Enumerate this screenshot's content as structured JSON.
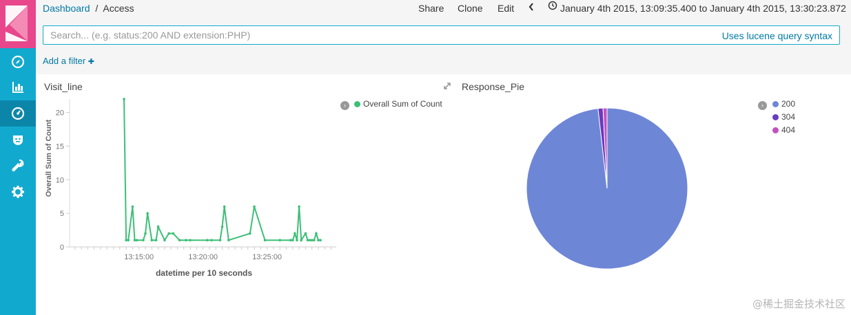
{
  "breadcrumb": {
    "parent": "Dashboard",
    "separator": "/",
    "current": "Access"
  },
  "top_menu": {
    "share": "Share",
    "clone": "Clone",
    "edit": "Edit"
  },
  "time_range": "January 4th 2015, 13:09:35.400 to January 4th 2015, 13:30:23.872",
  "search": {
    "placeholder": "Search... (e.g. status:200 AND extension:PHP)",
    "value": "",
    "syntax_link": "Uses lucene query syntax"
  },
  "filter": {
    "add_label": "Add a filter",
    "plus": "✚"
  },
  "sidebar": {
    "items": [
      {
        "name": "discover",
        "icon": "compass-icon",
        "active": false
      },
      {
        "name": "visualize",
        "icon": "bar-chart-icon",
        "active": false
      },
      {
        "name": "dashboard",
        "icon": "gauge-icon",
        "active": true
      },
      {
        "name": "timelion",
        "icon": "shield-face-icon",
        "active": false
      },
      {
        "name": "dev-tools",
        "icon": "wrench-icon",
        "active": false
      },
      {
        "name": "management",
        "icon": "gear-icon",
        "active": false
      }
    ]
  },
  "colors": {
    "accent": "#12a9cf",
    "logo": "#e8478b",
    "line": "#3cbf76",
    "slice_200": "#6e86d6",
    "slice_304": "#6a3bbf",
    "slice_404": "#c451c1"
  },
  "panels": {
    "visit_line": {
      "title": "Visit_line",
      "legend": "Overall Sum of Count",
      "toggle": "›"
    },
    "response_pie": {
      "title": "Response_Pie",
      "toggle": "›"
    }
  },
  "chart_data": [
    {
      "type": "line",
      "title": "Visit_line",
      "xlabel": "datetime per 10 seconds",
      "ylabel": "Overall Sum of Count",
      "x_ticks": [
        "13:15:00",
        "13:20:00",
        "13:25:00"
      ],
      "y_ticks": [
        0,
        5,
        10,
        15,
        20
      ],
      "ylim": [
        0,
        22
      ],
      "xlim": [
        "13:09:35",
        "13:30:24"
      ],
      "series": [
        {
          "name": "Overall Sum of Count",
          "x": [
            "13:13:50",
            "13:14:00",
            "13:14:10",
            "13:14:30",
            "13:14:40",
            "13:14:50",
            "13:15:20",
            "13:15:30",
            "13:15:40",
            "13:16:00",
            "13:16:20",
            "13:16:30",
            "13:17:00",
            "13:17:20",
            "13:17:40",
            "13:18:10",
            "13:18:40",
            "13:19:00",
            "13:20:20",
            "13:20:40",
            "13:21:20",
            "13:21:30",
            "13:21:40",
            "13:22:00",
            "13:23:40",
            "13:24:00",
            "13:24:50",
            "13:26:00",
            "13:26:50",
            "13:27:00",
            "13:27:10",
            "13:27:20",
            "13:27:30",
            "13:27:40",
            "13:28:00",
            "13:28:10",
            "13:28:20",
            "13:28:30",
            "13:28:40",
            "13:28:50",
            "13:29:00",
            "13:29:10"
          ],
          "values": [
            22,
            1,
            1,
            6,
            1,
            1,
            1,
            2,
            5,
            1,
            1,
            3,
            1,
            2,
            2,
            1,
            1,
            1,
            1,
            1,
            1,
            3,
            6,
            1,
            2,
            6,
            1,
            1,
            1,
            1,
            2,
            1,
            6,
            1,
            2,
            1,
            1,
            1,
            1,
            2,
            1,
            1
          ]
        }
      ]
    },
    {
      "type": "pie",
      "title": "Response_Pie",
      "categories": [
        "200",
        "304",
        "404"
      ],
      "values": [
        98.2,
        1.0,
        0.8
      ]
    }
  ]
}
